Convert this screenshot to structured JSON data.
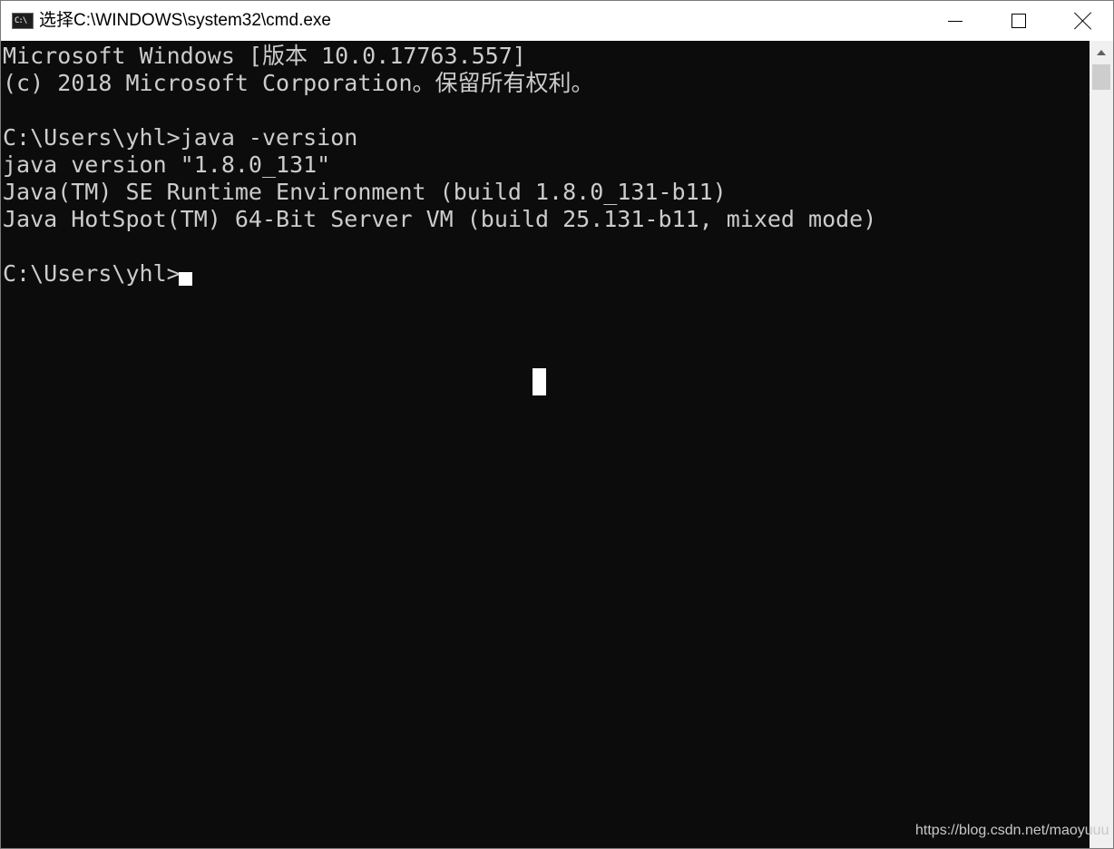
{
  "window": {
    "title": "选择C:\\WINDOWS\\system32\\cmd.exe",
    "icon": "cmd-icon",
    "icon_glyph": "C:\\"
  },
  "console": {
    "lines": [
      "Microsoft Windows [版本 10.0.17763.557]",
      "(c) 2018 Microsoft Corporation。保留所有权利。",
      "",
      "C:\\Users\\yhl>java -version",
      "java version \"1.8.0_131\"",
      "Java(TM) SE Runtime Environment (build 1.8.0_131-b11)",
      "Java HotSpot(TM) 64-Bit Server VM (build 25.131-b11, mixed mode)",
      "",
      "C:\\Users\\yhl>"
    ]
  },
  "watermark": "https://blog.csdn.net/maoyuuu",
  "colors": {
    "console_bg": "#0c0c0c",
    "console_text": "#cccccc",
    "titlebar_bg": "#ffffff"
  }
}
